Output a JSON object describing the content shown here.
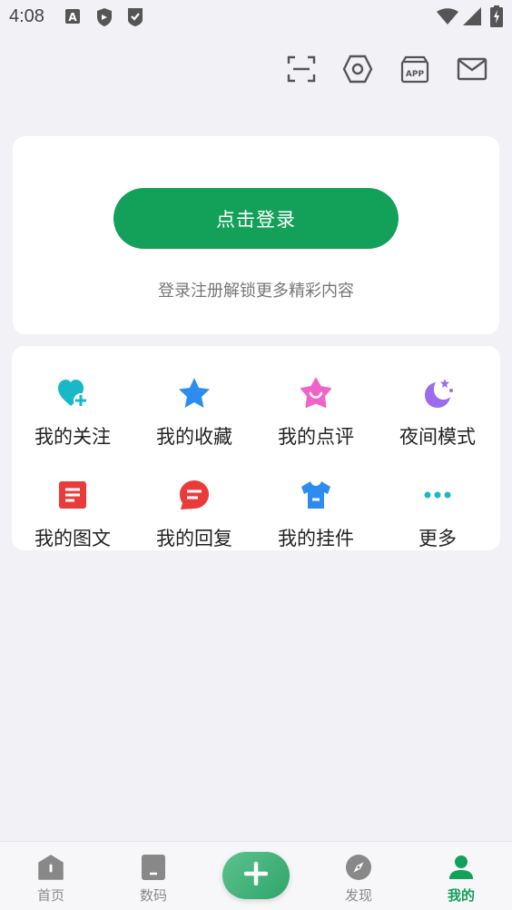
{
  "status_bar": {
    "time": "4:08",
    "icons": [
      "text-a-icon",
      "shield-icon",
      "check-shield-icon",
      "wifi-icon",
      "signal-icon",
      "battery-charging-icon"
    ]
  },
  "top_actions": [
    "scan-icon",
    "settings-icon",
    "app-icon",
    "mail-icon"
  ],
  "login": {
    "button_label": "点击登录",
    "subtitle": "登录注册解锁更多精彩内容"
  },
  "grid": {
    "items": [
      {
        "label": "我的关注",
        "icon": "heart-plus-icon",
        "color": "#19b8c8"
      },
      {
        "label": "我的收藏",
        "icon": "star-icon",
        "color": "#2d8cf0"
      },
      {
        "label": "我的点评",
        "icon": "smile-star-icon",
        "color": "#f064c8"
      },
      {
        "label": "夜间模式",
        "icon": "moon-icon",
        "color": "#9b6cf0"
      },
      {
        "label": "我的图文",
        "icon": "document-icon",
        "color": "#ea3b3b"
      },
      {
        "label": "我的回复",
        "icon": "chat-bubble-icon",
        "color": "#ea3b3b"
      },
      {
        "label": "我的挂件",
        "icon": "tshirt-icon",
        "color": "#2d8cf0"
      },
      {
        "label": "更多",
        "icon": "more-dots-icon",
        "color": "#19b8c8"
      }
    ]
  },
  "bottom_nav": {
    "items": [
      {
        "label": "首页",
        "icon": "home-icon"
      },
      {
        "label": "数码",
        "icon": "device-icon"
      },
      {
        "label": "发现",
        "icon": "compass-icon"
      },
      {
        "label": "我的",
        "icon": "user-icon",
        "active": true
      }
    ],
    "add_icon": "plus-icon"
  },
  "colors": {
    "accent": "#13a059",
    "background": "#f2f2f6"
  }
}
